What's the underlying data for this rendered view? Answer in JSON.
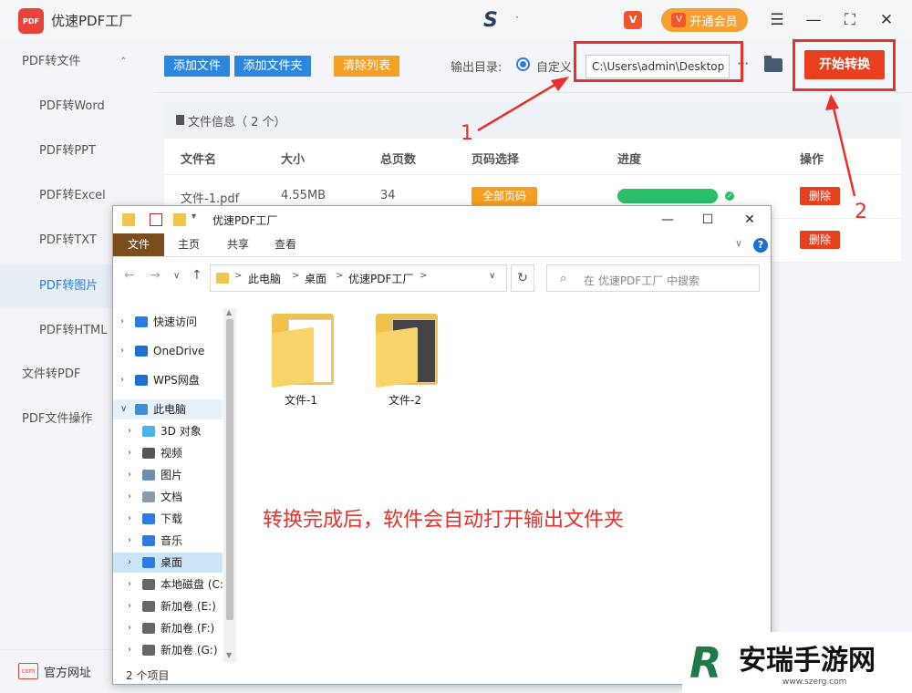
{
  "app": {
    "title": "优速PDF工厂",
    "logo_text": "PDF",
    "brand_mark": "S",
    "brand_dot": "·",
    "vip_badge": "V",
    "vip_label": "开通会员",
    "menu_glyph": "☰",
    "min_glyph": "—",
    "max_glyph": "⛶",
    "close_glyph": "✕"
  },
  "sidebar": {
    "groups": [
      {
        "label": "PDF转文件",
        "caret": "˄"
      },
      {
        "label": "文件转PDF"
      },
      {
        "label": "PDF文件操作"
      }
    ],
    "items": [
      {
        "label": "PDF转Word"
      },
      {
        "label": "PDF转PPT"
      },
      {
        "label": "PDF转Excel"
      },
      {
        "label": "PDF转TXT"
      },
      {
        "label": "PDF转图片"
      },
      {
        "label": "PDF转HTML"
      }
    ],
    "bottom_icon_text": "com",
    "bottom_label": "官方网址"
  },
  "toolbar": {
    "add_file": "添加文件",
    "add_folder": "添加文件夹",
    "clear_list": "清除列表",
    "output_label": "输出目录:",
    "radio_label": "自定义",
    "path_value": "C:\\Users\\admin\\Desktop",
    "more": "···",
    "start": "开始转换",
    "colors": {
      "blue": "#2b86e0",
      "orange": "#f5a023",
      "red": "#e8401f"
    }
  },
  "panel": {
    "title": "文件信息（ 2 个）",
    "columns": [
      "文件名",
      "大小",
      "总页数",
      "页码选择",
      "进度",
      "操作"
    ],
    "rows": [
      {
        "name": "文件-1.pdf",
        "size": "4.55MB",
        "pages": "34",
        "page_select": "全部页码",
        "progress": 1.0,
        "action": "删除"
      },
      {
        "action": "删除"
      }
    ],
    "check": "✓"
  },
  "explorer": {
    "title": "优速PDF工厂",
    "pin_glyph": "▾",
    "min_glyph": "—",
    "max_glyph": "☐",
    "close_glyph": "✕",
    "ribbon": [
      "文件",
      "主页",
      "共享",
      "查看"
    ],
    "ribbon_chevron": "∨",
    "help": "?",
    "nav": {
      "back": "←",
      "forward": "→",
      "dropdown": "∨",
      "up": "↑",
      "sep": ">"
    },
    "breadcrumbs": [
      "此电脑",
      "桌面",
      "优速PDF工厂"
    ],
    "refresh": "↻",
    "search_placeholder": "在 优速PDF工厂 中搜索",
    "search_glyph": "⌕",
    "tree": [
      {
        "label": "快速访问",
        "icon": "star-icon",
        "color": "#2b7be0"
      },
      {
        "label": "OneDrive",
        "icon": "cloud-icon",
        "color": "#1f6fd0"
      },
      {
        "label": "WPS网盘",
        "icon": "cloud-icon",
        "color": "#1f6fd0"
      },
      {
        "label": "此电脑",
        "icon": "computer-icon",
        "color": "#3b8fd6"
      },
      {
        "label": "3D 对象",
        "icon": "cube-icon",
        "color": "#4db3e6"
      },
      {
        "label": "视频",
        "icon": "film-icon",
        "color": "#555555"
      },
      {
        "label": "图片",
        "icon": "picture-icon",
        "color": "#6a8fb0"
      },
      {
        "label": "文档",
        "icon": "document-icon",
        "color": "#8a9bb0"
      },
      {
        "label": "下载",
        "icon": "download-icon",
        "color": "#2b7be0"
      },
      {
        "label": "音乐",
        "icon": "music-icon",
        "color": "#2b7be0"
      },
      {
        "label": "桌面",
        "icon": "desktop-icon",
        "color": "#2b7be0"
      },
      {
        "label": "本地磁盘 (C:",
        "icon": "disk-icon",
        "color": "#666666"
      },
      {
        "label": "新加卷 (E:)",
        "icon": "disk-icon",
        "color": "#666666"
      },
      {
        "label": "新加卷 (F:)",
        "icon": "disk-icon",
        "color": "#666666"
      },
      {
        "label": "新加卷 (G:)",
        "icon": "disk-icon",
        "color": "#666666"
      }
    ],
    "tree_expand": "›",
    "tree_expand_open": "∨",
    "folders": [
      "文件-1",
      "文件-2"
    ],
    "status": "2 个项目",
    "scroll_up": "▲",
    "scroll_down": "▼"
  },
  "annotations": {
    "message": "转换完成后，软件会自动打开输出文件夹",
    "marker_1": "1",
    "marker_2": "2"
  },
  "watermark": {
    "logo": "R",
    "text": "安瑞手游网",
    "url": "www.szerg.com"
  }
}
